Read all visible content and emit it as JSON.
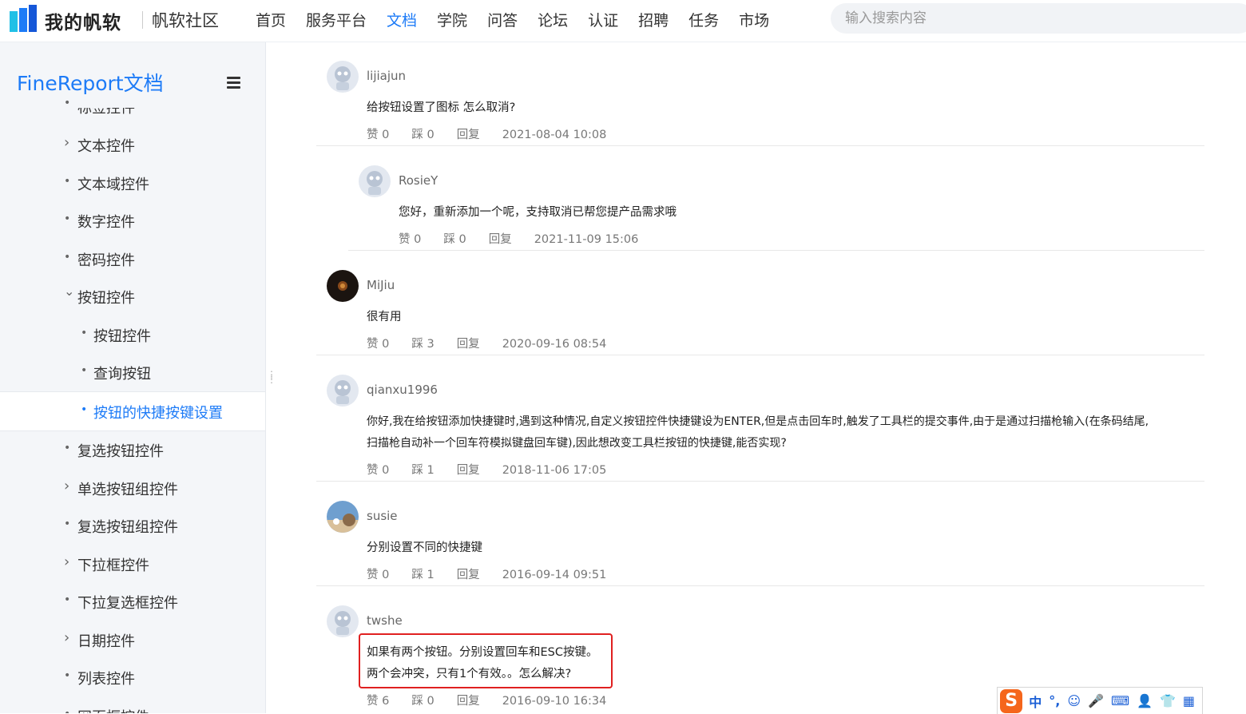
{
  "header": {
    "logo_text": "我的帆软",
    "community": "帆软社区",
    "nav": [
      "首页",
      "服务平台",
      "文档",
      "学院",
      "问答",
      "论坛",
      "认证",
      "招聘",
      "任务",
      "市场"
    ],
    "active_nav": "文档",
    "search_placeholder": "输入搜索内容"
  },
  "sidebar": {
    "title": "FineReport文档",
    "items": [
      {
        "label": "标签控件",
        "marker": "•"
      },
      {
        "label": "文本控件",
        "marker": "›"
      },
      {
        "label": "文本域控件",
        "marker": "•"
      },
      {
        "label": "数字控件",
        "marker": "•"
      },
      {
        "label": "密码控件",
        "marker": "•"
      },
      {
        "label": "按钮控件",
        "marker": "⌄"
      },
      {
        "label": "按钮控件",
        "marker": "•"
      },
      {
        "label": "查询按钮",
        "marker": "•"
      },
      {
        "label": "按钮的快捷按键设置",
        "marker": "•"
      },
      {
        "label": "复选按钮控件",
        "marker": "•"
      },
      {
        "label": "单选按钮组控件",
        "marker": "›"
      },
      {
        "label": "复选按钮组控件",
        "marker": "•"
      },
      {
        "label": "下拉框控件",
        "marker": "›"
      },
      {
        "label": "下拉复选框控件",
        "marker": "•"
      },
      {
        "label": "日期控件",
        "marker": "›"
      },
      {
        "label": "列表控件",
        "marker": "•"
      },
      {
        "label": "网页框控件",
        "marker": "•"
      }
    ]
  },
  "comments": [
    {
      "user": "lijiajun",
      "lines": [
        "给按钮设置了图标 怎么取消?"
      ],
      "like": "赞 0",
      "dislike": "踩 0",
      "reply": "回复",
      "date": "2021-08-04 10:08"
    },
    {
      "user": "RosieY",
      "lines": [
        "您好，重新添加一个呢，支持取消已帮您提产品需求哦"
      ],
      "like": "赞 0",
      "dislike": "踩 0",
      "reply": "回复",
      "date": "2021-11-09 15:06"
    },
    {
      "user": "MiJiu",
      "lines": [
        "很有用"
      ],
      "like": "赞 0",
      "dislike": "踩 3",
      "reply": "回复",
      "date": "2020-09-16 08:54"
    },
    {
      "user": "qianxu1996",
      "lines": [
        "你好,我在给按钮添加快捷键时,遇到这种情况,自定义按钮控件快捷键设为ENTER,但是点击回车时,触发了工具栏的提交事件,由于是通过扫描枪输入(在条码结尾,",
        "扫描枪自动补一个回车符模拟键盘回车键),因此想改变工具栏按钮的快捷键,能否实现?"
      ],
      "like": "赞 0",
      "dislike": "踩 1",
      "reply": "回复",
      "date": "2018-11-06 17:05"
    },
    {
      "user": "susie",
      "lines": [
        "分别设置不同的快捷键"
      ],
      "like": "赞 0",
      "dislike": "踩 1",
      "reply": "回复",
      "date": "2016-09-14 09:51"
    },
    {
      "user": "twshe",
      "lines": [
        "如果有两个按钮。分别设置回车和ESC按键。",
        "两个会冲突，只有1个有效。。怎么解决?"
      ],
      "like": "赞 6",
      "dislike": "踩 0",
      "reply": "回复",
      "date": "2016-09-10 16:34"
    }
  ],
  "ime": {
    "logo": "S",
    "items": [
      "中",
      "°,",
      "☺",
      "🎤",
      "⌨",
      "👤",
      "👕",
      "▦"
    ]
  }
}
